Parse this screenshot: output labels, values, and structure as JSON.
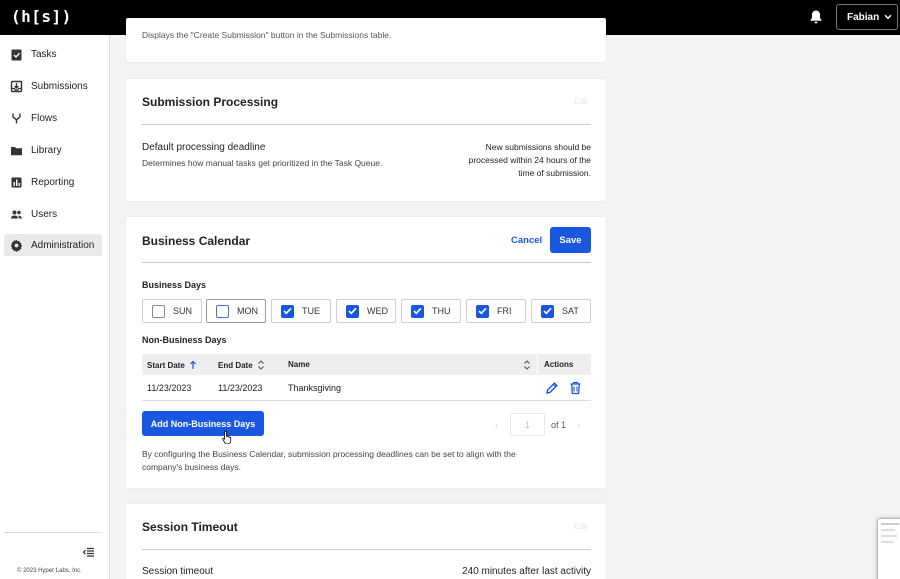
{
  "app": {
    "logo": "(h[s])",
    "user_name": "Fabian"
  },
  "sidebar": {
    "items": [
      {
        "label": "Tasks",
        "icon": "clipboard-check-icon"
      },
      {
        "label": "Submissions",
        "icon": "inbox-icon"
      },
      {
        "label": "Flows",
        "icon": "fork-icon"
      },
      {
        "label": "Library",
        "icon": "folder-icon"
      },
      {
        "label": "Reporting",
        "icon": "bar-chart-icon"
      },
      {
        "label": "Users",
        "icon": "users-icon"
      },
      {
        "label": "Administration",
        "icon": "gear-icon",
        "active": true
      }
    ],
    "copyright": "© 2023 Hyper Labs, Inc."
  },
  "top_card": {
    "text": "Displays the \"Create Submission\" button in the Submissions table."
  },
  "submission_processing": {
    "title": "Submission Processing",
    "edit_label": "Edit",
    "setting_label": "Default processing deadline",
    "setting_desc": "Determines how manual tasks get prioritized in the Task Queue.",
    "value_line1": "New submissions should be",
    "value_line2": "processed within 24 hours of the",
    "value_line3": "time of submission."
  },
  "business_calendar": {
    "title": "Business Calendar",
    "cancel_label": "Cancel",
    "save_label": "Save",
    "business_days_label": "Business Days",
    "days": [
      {
        "label": "SUN",
        "checked": false
      },
      {
        "label": "MON",
        "checked": false
      },
      {
        "label": "TUE",
        "checked": true
      },
      {
        "label": "WED",
        "checked": true
      },
      {
        "label": "THU",
        "checked": true
      },
      {
        "label": "FRI",
        "checked": true
      },
      {
        "label": "SAT",
        "checked": true
      }
    ],
    "non_business_label": "Non-Business Days",
    "columns": {
      "start": "Start Date",
      "end": "End Date",
      "name": "Name",
      "actions": "Actions"
    },
    "rows": [
      {
        "start": "11/23/2023",
        "end": "11/23/2023",
        "name": "Thanksgiving"
      }
    ],
    "add_button": "Add Non-Business Days",
    "page": "1",
    "page_of": "of 1",
    "footnote_line1": "By configuring the Business Calendar, submission processing deadlines can be set to align with the",
    "footnote_line2": "company's business days."
  },
  "session_timeout": {
    "title": "Session Timeout",
    "edit_label": "Edit",
    "setting_label": "Session timeout",
    "value": "240 minutes after last activity"
  },
  "colors": {
    "accent": "#1a57e0",
    "topbar": "#000000"
  }
}
